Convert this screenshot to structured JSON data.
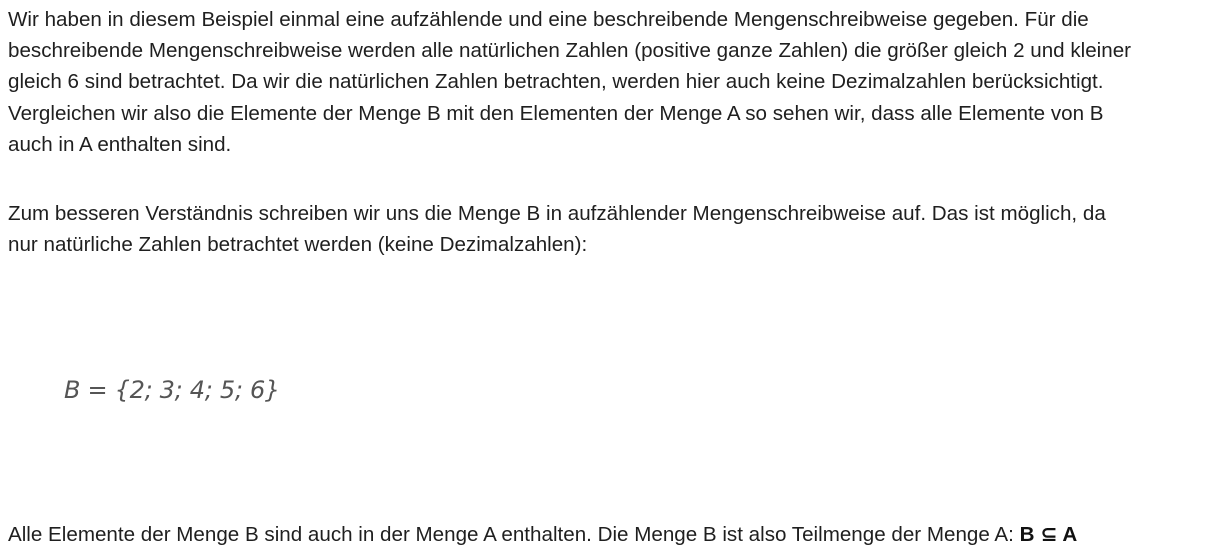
{
  "paragraph_1": {
    "lines": [
      "Wir haben in diesem Beispiel einmal eine aufzählende und eine beschreibende Mengenschreibweise gegeben. Für die",
      "beschreibende Mengenschreibweise werden alle natürlichen Zahlen (positive ganze Zahlen) die größer gleich 2 und kleiner",
      "gleich 6 sind betrachtet. Da wir die natürlichen Zahlen betrachten, werden hier auch keine Dezimalzahlen berücksichtigt.",
      "Vergleichen wir also die Elemente der Menge B mit den Elementen der Menge A so sehen wir, dass alle Elemente von B",
      "auch in A enthalten sind."
    ]
  },
  "paragraph_2": {
    "lines": [
      "Zum besseren Verständnis schreiben wir uns die Menge B in aufzählender Mengenschreibweise auf. Das ist möglich, da",
      "nur natürliche Zahlen betrachtet werden (keine Dezimalzahlen):"
    ]
  },
  "formula": {
    "text": "B = {2; 3; 4; 5; 6}"
  },
  "paragraph_3": {
    "text": "Alle Elemente der Menge B sind auch in der Menge A enthalten. Die Menge B ist also Teilmenge der Menge A: ",
    "conclusion": "B ⊆ A"
  }
}
